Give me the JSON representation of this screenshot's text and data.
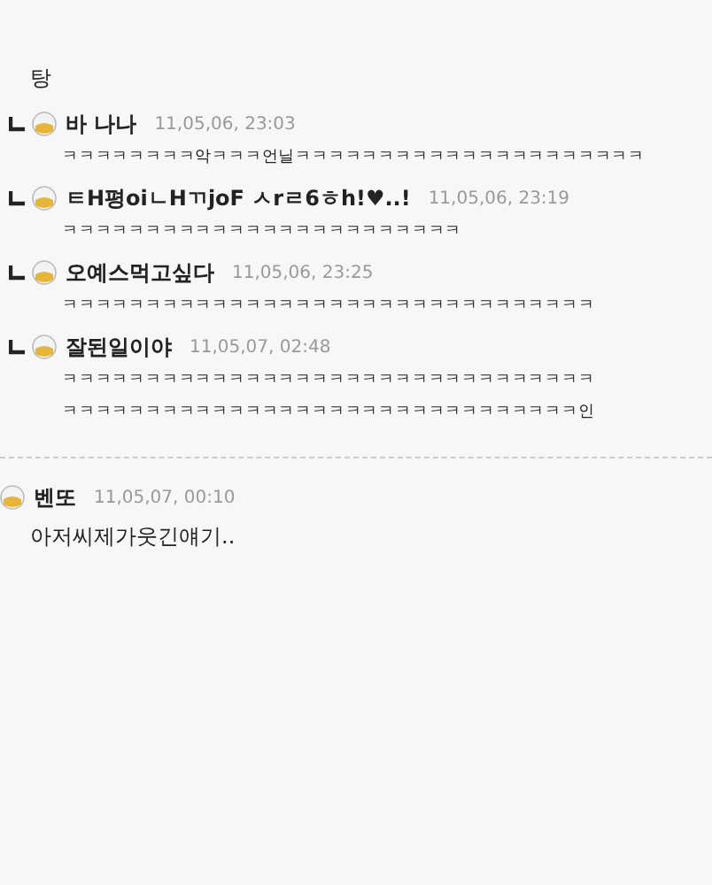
{
  "post_text": "탕",
  "replies": [
    {
      "name": "바 나나",
      "date": "11,05,06, 23:03",
      "lines": [
        "ㅋㅋㅋㅋㅋㅋㅋㅋ악ㅋㅋㅋ언닐ㅋㅋㅋㅋㅋㅋㅋㅋㅋㅋㅋㅋㅋㅋㅋㅋㅋㅋㅋㅋㅋ"
      ]
    },
    {
      "name": "ㅌH평oiㄴHㄲjoF ㅅrㄹ6ㅎh!♥..!",
      "date": "11,05,06, 23:19",
      "lines": [
        "ㅋㅋㅋㅋㅋㅋㅋㅋㅋㅋㅋㅋㅋㅋㅋㅋㅋㅋㅋㅋㅋㅋㅋㅋ"
      ]
    },
    {
      "name": "오예스먹고싶다",
      "date": "11,05,06, 23:25",
      "lines": [
        "ㅋㅋㅋㅋㅋㅋㅋㅋㅋㅋㅋㅋㅋㅋㅋㅋㅋㅋㅋㅋㅋㅋㅋㅋㅋㅋㅋㅋㅋㅋㅋㅋ"
      ]
    },
    {
      "name": "잘된일이야",
      "date": "11,05,07, 02:48",
      "lines": [
        "ㅋㅋㅋㅋㅋㅋㅋㅋㅋㅋㅋㅋㅋㅋㅋㅋㅋㅋㅋㅋㅋㅋㅋㅋㅋㅋㅋㅋㅋㅋㅋㅋ",
        "ㅋㅋㅋㅋㅋㅋㅋㅋㅋㅋㅋㅋㅋㅋㅋㅋㅋㅋㅋㅋㅋㅋㅋㅋㅋㅋㅋㅋㅋㅋㅋ인"
      ]
    }
  ],
  "comment": {
    "name": "벤또",
    "date": "11,05,07, 00:10",
    "text": "아저씨제가웃긴얘기.."
  }
}
